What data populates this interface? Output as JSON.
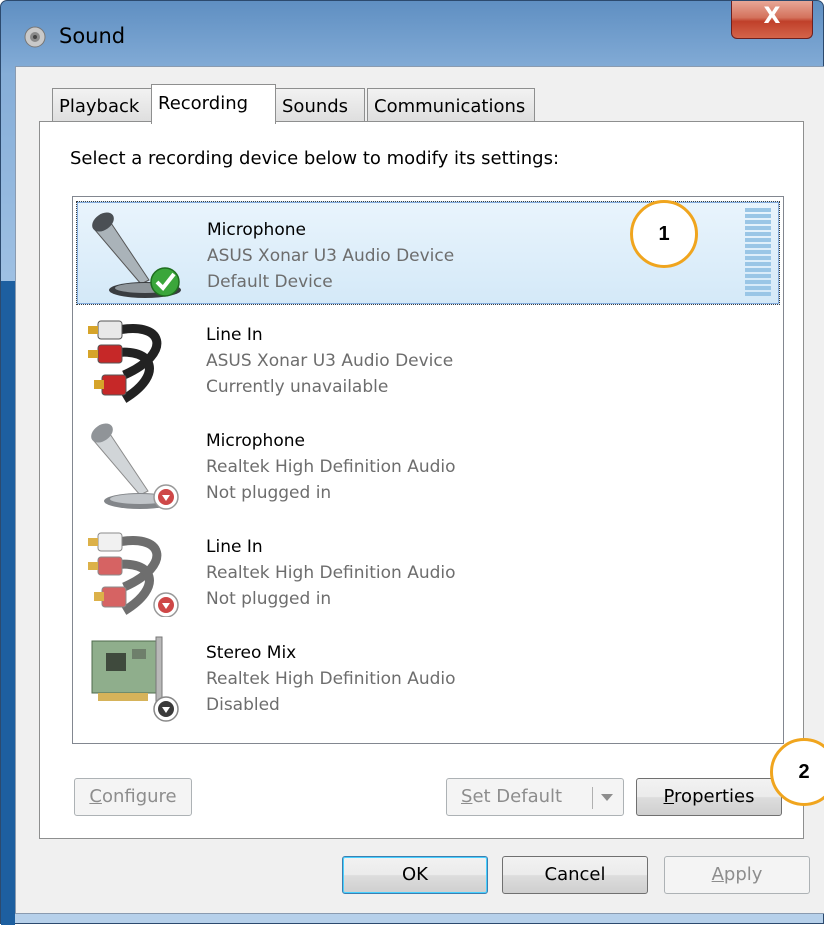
{
  "window": {
    "title": "Sound",
    "close_label": "X"
  },
  "tabs": [
    {
      "label": "Playback",
      "active": false
    },
    {
      "label": "Recording",
      "active": true
    },
    {
      "label": "Sounds",
      "active": false
    },
    {
      "label": "Communications",
      "active": false
    }
  ],
  "instruction": "Select a recording device below to modify its settings:",
  "devices": [
    {
      "name": "Microphone",
      "driver": "ASUS Xonar U3 Audio Device",
      "status": "Default Device",
      "icon": "microphone-icon",
      "badge": "check-icon",
      "selected": true
    },
    {
      "name": "Line In",
      "driver": "ASUS Xonar U3 Audio Device",
      "status": "Currently unavailable",
      "icon": "rca-cable-icon",
      "badge": "",
      "selected": false
    },
    {
      "name": "Microphone",
      "driver": "Realtek High Definition Audio",
      "status": "Not plugged in",
      "icon": "microphone-icon",
      "badge": "down-arrow-red-icon",
      "selected": false
    },
    {
      "name": "Line In",
      "driver": "Realtek High Definition Audio",
      "status": "Not plugged in",
      "icon": "rca-cable-icon",
      "badge": "down-arrow-red-icon",
      "selected": false
    },
    {
      "name": "Stereo Mix",
      "driver": "Realtek High Definition Audio",
      "status": "Disabled",
      "icon": "sound-card-icon",
      "badge": "down-arrow-gray-icon",
      "selected": false
    }
  ],
  "buttons": {
    "configure": {
      "prefix": "",
      "mnemonic": "C",
      "rest": "onfigure"
    },
    "set_default": {
      "mnemonic": "S",
      "rest": "et Default"
    },
    "properties": {
      "mnemonic": "P",
      "rest": "roperties"
    },
    "ok": "OK",
    "cancel": "Cancel",
    "apply": {
      "mnemonic": "A",
      "rest": "pply"
    }
  },
  "callouts": [
    "1",
    "2"
  ],
  "colors": {
    "selection": "#d4e9f8",
    "callout_border": "#f0a51e",
    "disabled_text": "#8d8d8d"
  }
}
